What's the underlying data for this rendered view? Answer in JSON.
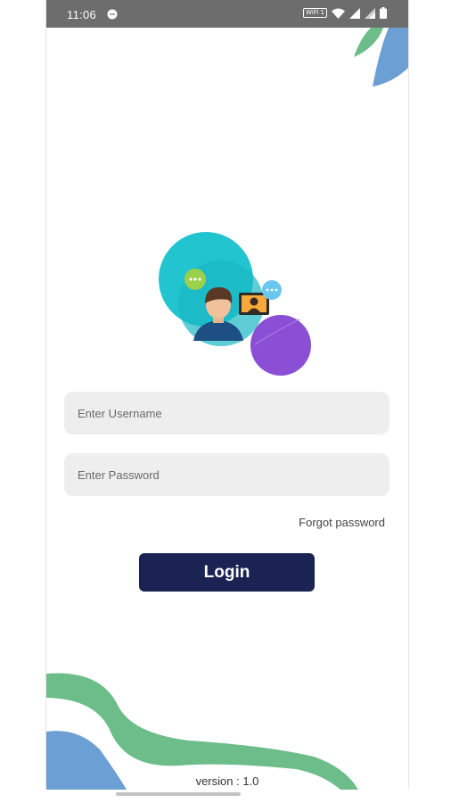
{
  "status_bar": {
    "time": "11:06",
    "wifi_badge": "WiFi 1",
    "icons": [
      "chat-bubble-icon",
      "wifi-icon",
      "signal-icon",
      "signal-icon",
      "battery-icon"
    ]
  },
  "login": {
    "username_placeholder": "Enter Username",
    "password_placeholder": "Enter Password",
    "forgot_password": "Forgot password",
    "login_button": "Login"
  },
  "footer": {
    "version": "version : 1.0"
  },
  "colors": {
    "primary": "#1a2352",
    "field_bg": "#eeeeee",
    "accent_green": "#6cbd8a",
    "accent_blue": "#6c9fd3",
    "accent_teal": "#22c4cf",
    "accent_purple": "#8a4fd4"
  }
}
